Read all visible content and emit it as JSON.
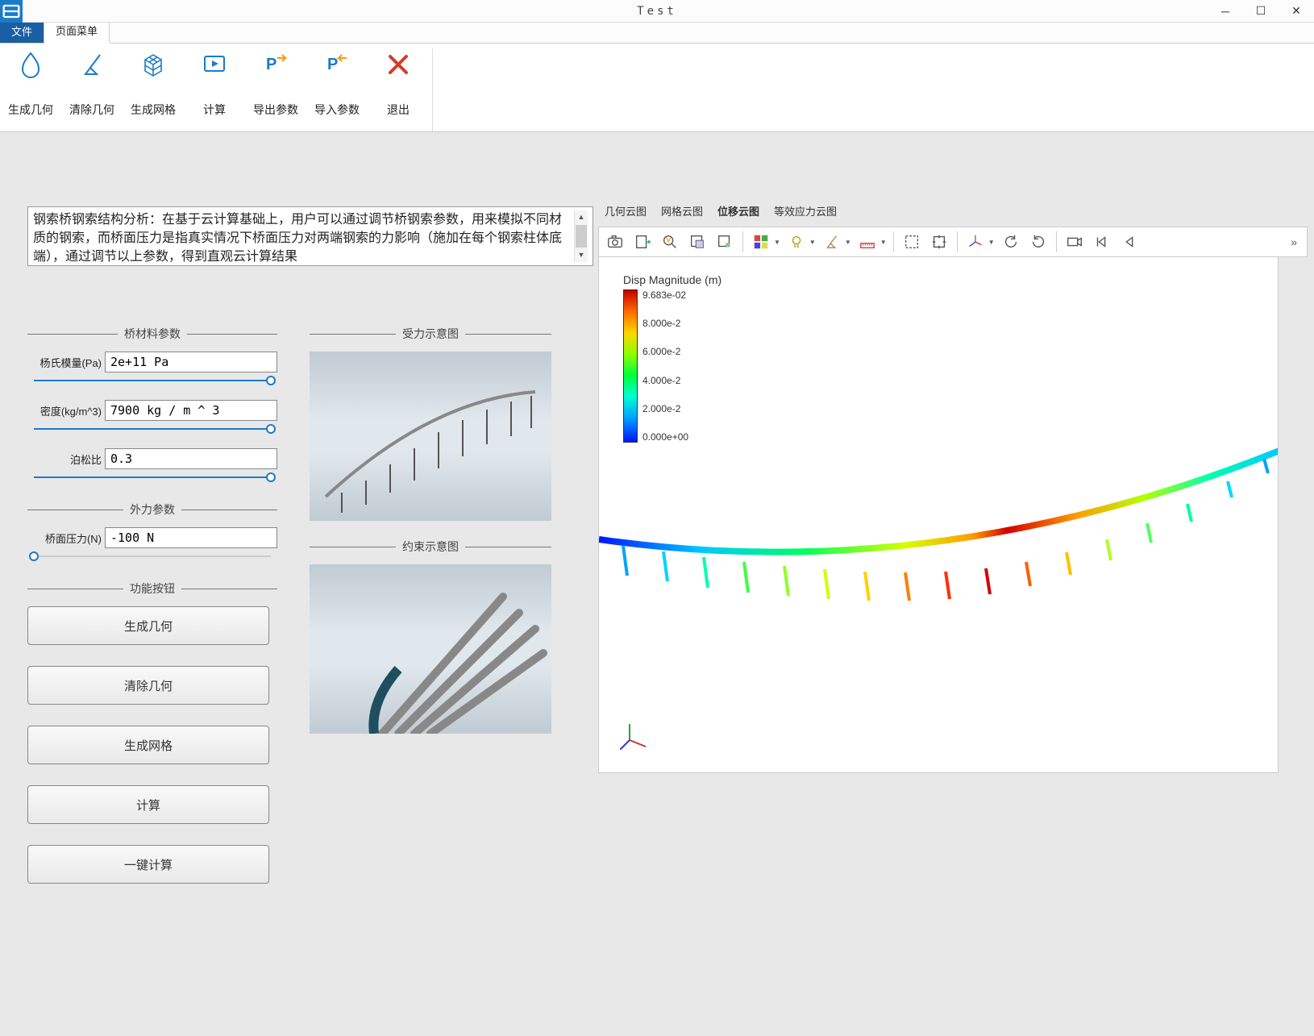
{
  "window": {
    "title": "Test"
  },
  "menu_tabs": {
    "file": "文件",
    "page_menu": "页面菜单"
  },
  "ribbon": {
    "gen_geom": "生成几何",
    "clear_geom": "清除几何",
    "gen_mesh": "生成网格",
    "calc": "计算",
    "export_params": "导出参数",
    "import_params": "导入参数",
    "exit": "退出"
  },
  "description": "钢索桥钢索结构分析：在基于云计算基础上，用户可以通过调节桥钢索参数，用来模拟不同材质的钢索，而桥面压力是指真实情况下桥面压力对两端钢索的力影响（施加在每个钢索柱体底端），通过调节以上参数，得到直观云计算结果",
  "params": {
    "material_header": "桥材料参数",
    "youngs_label": "杨氏模量(Pa)",
    "youngs_value": "2e+11 Pa",
    "density_label": "密度(kg/m^3)",
    "density_value": "7900 kg / m ^ 3",
    "poisson_label": "泊松比",
    "poisson_value": "0.3",
    "force_header": "外力参数",
    "pressure_label": "桥面压力(N)",
    "pressure_value": "-100 N",
    "fn_header": "功能按钮"
  },
  "buttons": {
    "gen_geom": "生成几何",
    "clear_geom": "清除几何",
    "gen_mesh": "生成网格",
    "calc": "计算",
    "one_click": "一键计算"
  },
  "diagrams": {
    "force_title": "受力示意图",
    "constraint_title": "约束示意图"
  },
  "viz_tabs": {
    "geom": "几何云图",
    "mesh": "网格云图",
    "disp": "位移云图",
    "stress": "等效应力云图"
  },
  "legend": {
    "title": "Disp Magnitude (m)",
    "ticks": [
      "9.683e-02",
      "8.000e-2",
      "6.000e-2",
      "4.000e-2",
      "2.000e-2",
      "0.000e+00"
    ]
  },
  "colors": {
    "accent": "#1a7bc9",
    "file_tab": "#1a5ea3"
  }
}
